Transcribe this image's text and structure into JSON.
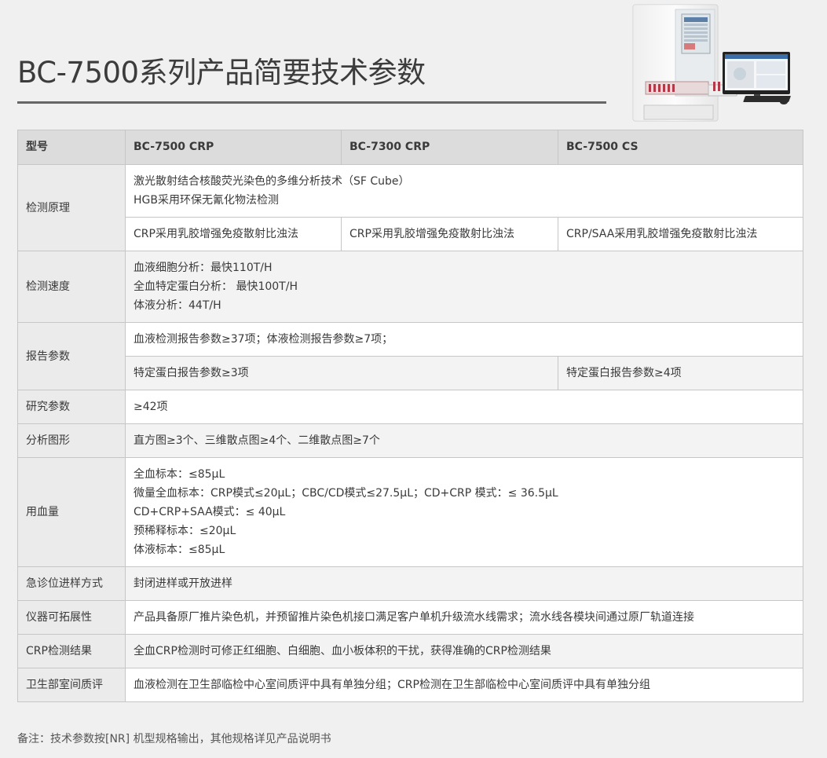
{
  "page": {
    "title": "BC-7500系列产品简要技术参数",
    "note": "备注：技术参数按[NR] 机型规格输出，其他规格详见产品说明书"
  },
  "table": {
    "header": {
      "model": "型号",
      "col1": "BC-7500 CRP",
      "col2": "BC-7300 CRP",
      "col3": "BC-7500 CS"
    },
    "principle": {
      "label": "检测原理",
      "line1": "激光散射结合核酸荧光染色的多维分析技术（SF Cube）",
      "line2": "HGB采用环保无氰化物法检测",
      "crp1": "CRP采用乳胶增强免疫散射比浊法",
      "crp2": "CRP采用乳胶增强免疫散射比浊法",
      "crp3": "CRP/SAA采用乳胶增强免疫散射比浊法"
    },
    "speed": {
      "label": "检测速度",
      "line1": "血液细胞分析：最快110T/H",
      "line2": "全血特定蛋白分析： 最快100T/H",
      "line3": "体液分析：44T/H"
    },
    "report": {
      "label": "报告参数",
      "line1": "血液检测报告参数≥37项；体液检测报告参数≥7项；",
      "protein_a": "特定蛋白报告参数≥3项",
      "protein_b": "特定蛋白报告参数≥4项"
    },
    "research": {
      "label": "研究参数",
      "value": "≥42项"
    },
    "graphs": {
      "label": "分析图形",
      "value": "直方图≥3个、三维散点图≥4个、二维散点图≥7个"
    },
    "blood_volume": {
      "label": "用血量",
      "line1": "全血标本：≤85μL",
      "line2": "微量全血标本：CRP模式≤20μL；CBC/CD模式≤27.5μL；CD+CRP 模式：≤ 36.5μL",
      "line3": "CD+CRP+SAA模式：≤ 40μL",
      "line4": "预稀释标本：≤20μL",
      "line5": "体液标本：≤85μL"
    },
    "emergency": {
      "label": "急诊位进样方式",
      "value": "封闭进样或开放进样"
    },
    "expansion": {
      "label": "仪器可拓展性",
      "value": "产品具备原厂推片染色机，并预留推片染色机接口满足客户单机升级流水线需求；流水线各模块间通过原厂轨道连接"
    },
    "crp_result": {
      "label": "CRP检测结果",
      "value": "全血CRP检测时可修正红细胞、白细胞、血小板体积的干扰，获得准确的CRP检测结果"
    },
    "quality": {
      "label": "卫生部室间质评",
      "value": "血液检测在卫生部临检中心室间质评中具有单独分组；CRP检测在卫生部临检中心室间质评中具有单独分组"
    }
  },
  "colors": {
    "background": "#f0f0f0",
    "header_row": "#dcdcdc",
    "label_cell": "#ebebeb",
    "border": "#c6c6c6",
    "title_text": "#3c3c3c"
  }
}
